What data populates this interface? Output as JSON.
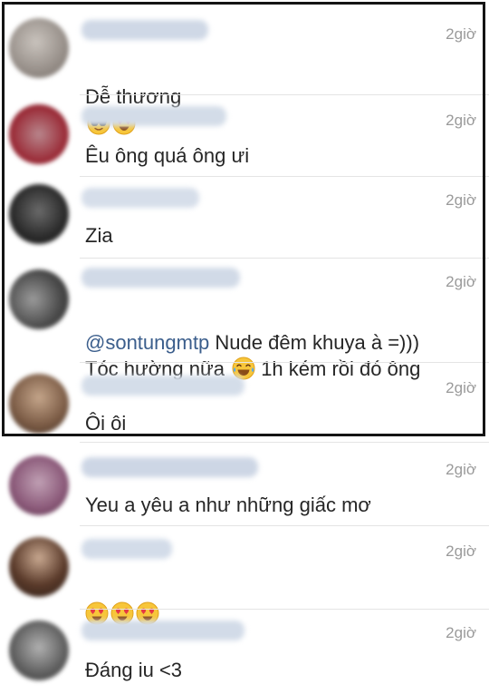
{
  "comments": [
    {
      "time": "2giờ",
      "text": "Dễ thương",
      "emoji_after": [
        "cool-face-icon",
        "heart-eyes-icon"
      ]
    },
    {
      "time": "2giờ",
      "text": "Êu ông quá ông ưi"
    },
    {
      "time": "2giờ",
      "text": "Zia"
    },
    {
      "time": "2giờ",
      "mention": "@sontungmtp",
      "line1": " Nude đêm khuya à =)))",
      "line2a": "Tóc hường nữa ",
      "line2b": " 1h kém rồi đó ông",
      "emoji_mid": "tears-of-joy-icon"
    },
    {
      "time": "2giờ",
      "text": "Ôi ôi"
    },
    {
      "time": "2giờ",
      "text": "Yeu a yêu a như những giấc mơ"
    },
    {
      "time": "2giờ",
      "text": "",
      "emoji_after": [
        "heart-eyes-icon",
        "heart-eyes-icon",
        "heart-eyes-icon"
      ]
    },
    {
      "time": "2giờ",
      "text": "Đáng iu <3"
    }
  ],
  "colors": {
    "text": "#262626",
    "timestamp": "#9a9a9a",
    "mention": "#3b5e8c",
    "highlight_frame": "#141414"
  }
}
